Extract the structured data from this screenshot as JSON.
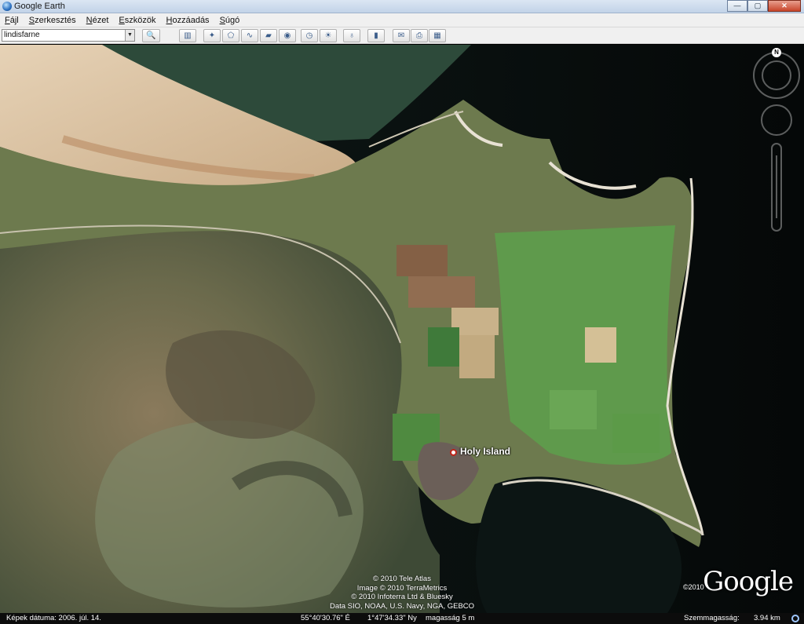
{
  "window": {
    "title": "Google Earth",
    "buttons": {
      "minimize": "—",
      "maximize": "▢",
      "close": "✕"
    }
  },
  "menu": {
    "items": [
      "Fájl",
      "Szerkesztés",
      "Nézet",
      "Eszközök",
      "Hozzáadás",
      "Súgó"
    ]
  },
  "toolbar": {
    "search_value": "lindisfarne",
    "buttons": [
      {
        "icon": "search-icon",
        "glyph": "🔍"
      },
      {
        "icon": "sidebar-toggle-icon",
        "glyph": "▥"
      },
      {
        "icon": "placemark-icon",
        "glyph": "✦"
      },
      {
        "icon": "polygon-icon",
        "glyph": "⬠"
      },
      {
        "icon": "path-icon",
        "glyph": "∿"
      },
      {
        "icon": "image-overlay-icon",
        "glyph": "▰"
      },
      {
        "icon": "record-tour-icon",
        "glyph": "◉"
      },
      {
        "icon": "historical-imagery-icon",
        "glyph": "◷"
      },
      {
        "icon": "sunlight-icon",
        "glyph": "☀"
      },
      {
        "icon": "planet-icon",
        "glyph": "♁"
      },
      {
        "icon": "ruler-icon",
        "glyph": "▮"
      },
      {
        "icon": "email-icon",
        "glyph": "✉"
      },
      {
        "icon": "print-icon",
        "glyph": "⎙"
      },
      {
        "icon": "view-in-maps-icon",
        "glyph": "▦"
      }
    ]
  },
  "map": {
    "place_label": "Holy Island",
    "credits": [
      "© 2010 Tele Atlas",
      "Image © 2010 TerraMetrics",
      "© 2010 Infoterra Ltd & Bluesky",
      "Data SIO, NOAA, U.S. Navy, NGA, GEBCO"
    ],
    "logo": "Google",
    "logo_year": "©2010",
    "compass_north": "N"
  },
  "status": {
    "image_date": "Képek dátuma: 2006. júl. 14.",
    "latitude": "55°40'30.76\" É",
    "longitude": "1°47'34.33\" Ny",
    "elevation": "magasság    5 m",
    "eye_altitude_label": "Szemmagasság:",
    "eye_altitude_value": "3.94 km"
  }
}
